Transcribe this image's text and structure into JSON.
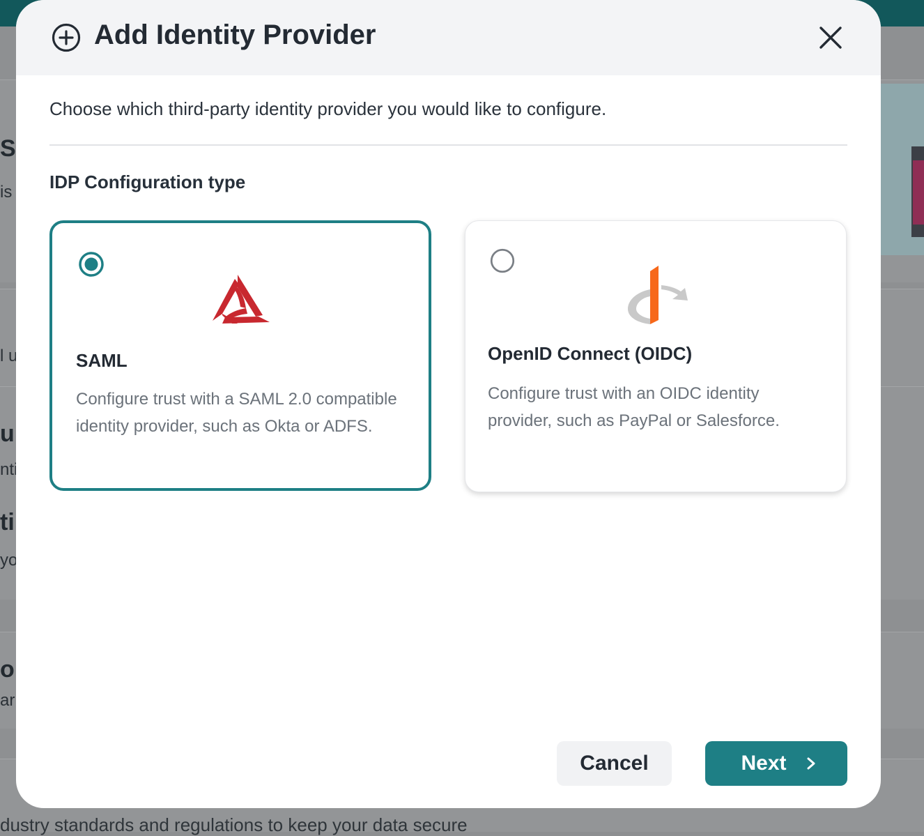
{
  "background": {
    "fragments": [
      "Se",
      "is",
      "l u",
      "ur",
      "nti",
      "ti",
      "yo",
      "o",
      "ar"
    ],
    "footer_text": "dustry standards and regulations to keep your data secure"
  },
  "modal": {
    "title": "Add Identity Provider",
    "header_icon": "plus-circle-icon",
    "close_icon": "close-icon",
    "intro": "Choose which third-party identity provider you would like to configure.",
    "section_label": "IDP Configuration type",
    "options": [
      {
        "id": "saml",
        "title": "SAML",
        "description": "Configure trust with a SAML 2.0 compatible identity provider, such as Okta or ADFS.",
        "selected": true,
        "logo_icon": "saml-logo-icon"
      },
      {
        "id": "oidc",
        "title": "OpenID Connect (OIDC)",
        "description": "Configure trust with an OIDC identity provider, such as PayPal or Salesforce.",
        "selected": false,
        "logo_icon": "openid-logo-icon"
      }
    ],
    "buttons": {
      "cancel": "Cancel",
      "next": "Next",
      "next_icon": "chevron-right-icon"
    }
  },
  "colors": {
    "accent": "#1e7f85",
    "saml_red": "#c8282f",
    "openid_orange": "#f7681a",
    "openid_gray": "#c9c9c9"
  }
}
